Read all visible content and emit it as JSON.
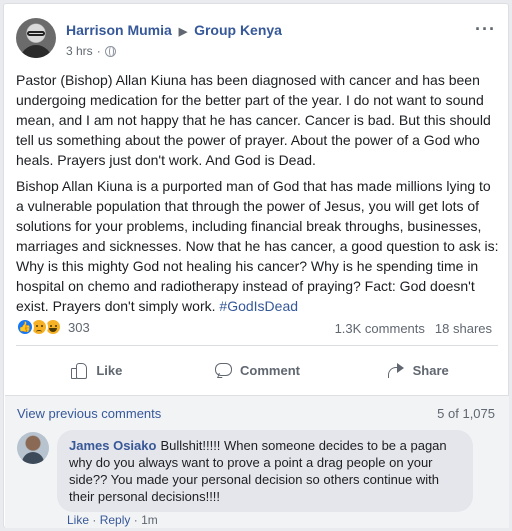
{
  "post": {
    "author": "Harrison Mumia",
    "group": "Group Kenya",
    "time": "3 hrs",
    "paragraphs": [
      "Pastor (Bishop) Allan Kiuna has been diagnosed with cancer and has been undergoing medication for the better part of the year. I do not want to sound mean, and I am not happy that he has cancer. Cancer is bad. But this should tell us something about the power of prayer. About the power of a God who heals. Prayers just don't work. And God is Dead.",
      "Bishop Allan Kiuna is a purported man of God that has made millions lying to a vulnerable population that through the power of Jesus, you will get lots of solutions for your problems, including financial break throughs, businesses, marriages and sicknesses. Now that he has cancer, a good question to ask is: Why is this mighty God not healing his cancer? Why is he spending time in hospital on chemo and radiotherapy instead of praying? Fact: God doesn't exist. Prayers don't simply work. "
    ],
    "hashtag": "#GodIsDead"
  },
  "reactions": {
    "count": "303",
    "comments": "1.3K comments",
    "shares": "18 shares"
  },
  "actions": {
    "like": "Like",
    "comment": "Comment",
    "share": "Share"
  },
  "comments": {
    "view_previous": "View previous comments",
    "position": "5 of 1,075",
    "item": {
      "author": "James Osiako",
      "text": "Bullshit!!!!! When someone decides to be a pagan why do you always want to prove a point a drag people on your side?? You made your personal decision so others continue with their personal decisions!!!!",
      "like": "Like",
      "separator": "·",
      "reply": "Reply",
      "time": "1m"
    }
  },
  "colors": {
    "link": "#365899",
    "muted": "#606770",
    "like_blue": "#1877f2",
    "emoji_yellow": "#f7b125"
  },
  "icons": [
    "more-icon",
    "globe-icon",
    "like-reaction-icon",
    "sad-reaction-icon",
    "haha-reaction-icon",
    "like-icon",
    "comment-icon",
    "share-icon"
  ]
}
